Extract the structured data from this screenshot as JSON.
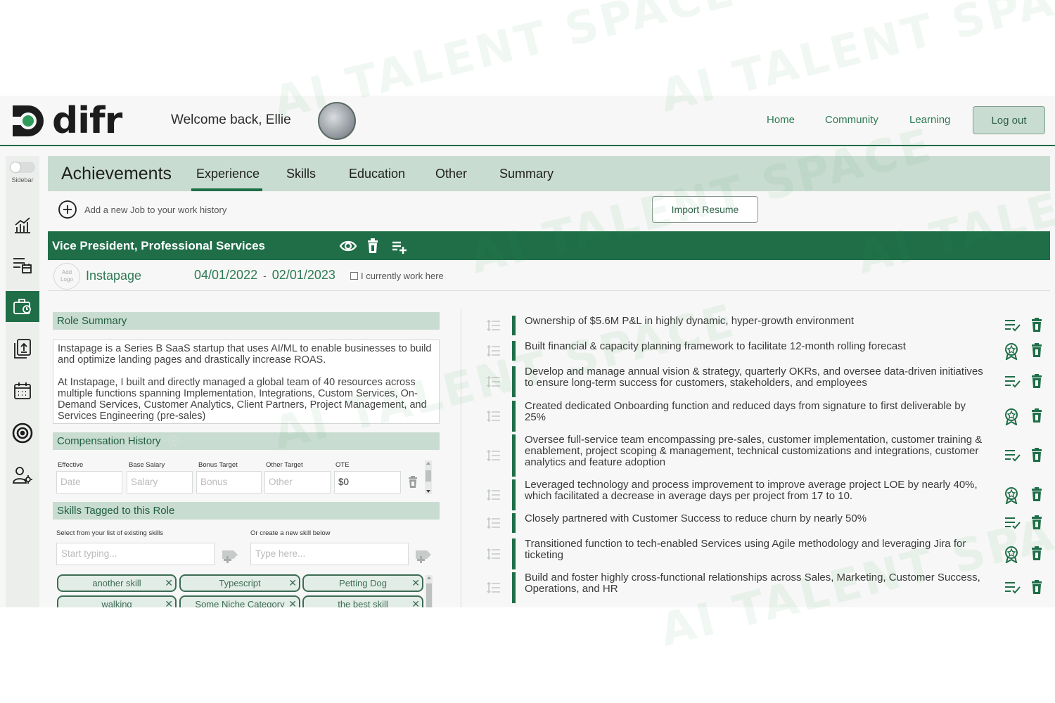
{
  "watermark": "AI TALENT SPACE",
  "header": {
    "logo_text": "difr",
    "welcome": "Welcome back, Ellie",
    "nav": [
      "Home",
      "Community",
      "Learning"
    ],
    "logout": "Log out"
  },
  "sidebar": {
    "toggle_label": "Sidebar",
    "icons": [
      "chart-icon",
      "list-calendar-icon",
      "briefcase-icon",
      "document-upload-icon",
      "calendar-icon",
      "target-icon",
      "user-settings-icon"
    ],
    "active": "briefcase-icon"
  },
  "tabs": {
    "title": "Achievements",
    "items": [
      "Experience",
      "Skills",
      "Education",
      "Other",
      "Summary"
    ],
    "active": "Experience"
  },
  "add_job": "Add a new Job to your work history",
  "import_resume": "Import Resume",
  "job": {
    "title": "Vice President, Professional Services",
    "add_logo": [
      "Add",
      "Logo"
    ],
    "company": "Instapage",
    "start": "04/01/2022",
    "separator": "-",
    "end": "02/01/2023",
    "current_label": "I currently work here",
    "current_checked": false
  },
  "role_summary": {
    "heading": "Role Summary",
    "paragraphs": [
      "Instapage is a Series B SaaS startup that uses AI/ML to enable businesses to build and optimize landing pages and drastically increase ROAS.",
      "At Instapage, I built and directly managed a global team of 40 resources across multiple functions spanning Implementation, Integrations, Custom Services, On-Demand Services, Customer Analytics, Client Partners, Project Management, and Services Engineering (pre-sales)"
    ]
  },
  "compensation": {
    "heading": "Compensation History",
    "labels": [
      "Effective",
      "Base Salary",
      "Bonus Target",
      "Other Target",
      "OTE"
    ],
    "placeholders": [
      "Date",
      "Salary",
      "Bonus",
      "Other"
    ],
    "ote_value": "$0"
  },
  "skills": {
    "heading": "Skills Tagged to this Role",
    "select_label": "Select from your list of existing skills",
    "create_label": "Or create a new skill below",
    "select_placeholder": "Start typing...",
    "create_placeholder": "Type here...",
    "chips": [
      "another skill",
      "Typescript",
      "Petting Dog",
      "walking",
      "Some Niche Category",
      "the best skill"
    ]
  },
  "achievements": [
    {
      "text": "Ownership of $5.6M P&L in highly dynamic, hyper-growth environment",
      "action": "checklist-icon"
    },
    {
      "text": "Built financial & capacity planning framework to facilitate 12-month rolling forecast",
      "action": "badge-icon"
    },
    {
      "text": "Develop and manage annual vision & strategy, quarterly OKRs, and oversee data-driven initiatives to ensure long-term success for customers, stakeholders, and employees",
      "action": "checklist-icon"
    },
    {
      "text": "Created dedicated Onboarding function and reduced days from signature to first deliverable by 25%",
      "action": "badge-icon"
    },
    {
      "text": "Oversee full-service team encompassing pre-sales, customer implementation, customer training & enablement, project scoping & management, technical customizations and integrations, customer analytics and feature adoption",
      "action": "checklist-icon"
    },
    {
      "text": "Leveraged technology and process improvement to improve average project LOE by nearly 40%, which facilitated a decrease in average days per project from 17 to 10.",
      "action": "badge-icon"
    },
    {
      "text": "Closely partnered with Customer Success to reduce churn by nearly 50%",
      "action": "checklist-icon"
    },
    {
      "text": "Transitioned function to tech-enabled Services using Agile methodology and leveraging Jira for ticketing",
      "action": "badge-icon"
    },
    {
      "text": "Build and foster highly cross-functional relationships across Sales, Marketing, Customer Success, Operations, and HR",
      "action": "checklist-icon"
    }
  ],
  "colors": {
    "primary": "#1f6e48",
    "tab_bg": "#c9dcd1",
    "link": "#2f7a55"
  }
}
